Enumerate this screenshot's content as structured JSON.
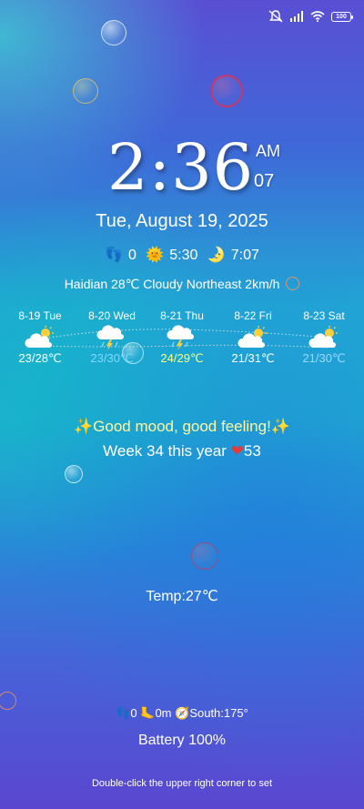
{
  "status_bar": {
    "battery": "100",
    "icons": [
      "notifications-off-icon",
      "cellular-signal-icon",
      "wifi-icon",
      "battery-icon"
    ]
  },
  "clock": {
    "time": "2:36",
    "ampm": "AM",
    "seconds": "07"
  },
  "date": "Tue, August 19, 2025",
  "stats": {
    "steps": "0",
    "sunrise": "5:30",
    "sunset": "7:07"
  },
  "location_weather": "Haidian 28℃ Cloudy Northeast 2km/h",
  "forecast": [
    {
      "label": "8-19 Tue",
      "icon": "partly-cloudy-icon",
      "temps": "23/28℃",
      "color": "#ffffff"
    },
    {
      "label": "8-20 Wed",
      "icon": "thunderstorm-icon",
      "temps": "23/30℃",
      "color": "#7fd8ff"
    },
    {
      "label": "8-21 Thu",
      "icon": "thunderstorm-icon",
      "temps": "24/29℃",
      "color": "#f4ff8a"
    },
    {
      "label": "8-22 Fri",
      "icon": "partly-cloudy-icon",
      "temps": "21/31℃",
      "color": "#ffffff"
    },
    {
      "label": "8-23 Sat",
      "icon": "partly-cloudy-icon",
      "temps": "21/30℃",
      "color": "#9fd8ff"
    }
  ],
  "mood": "✨Good mood, good feeling!✨",
  "week": {
    "text": "Week 34 this year",
    "days": "53"
  },
  "temperature": "Temp:27℃",
  "sensors": {
    "steps": "0",
    "altitude": "0m",
    "compass": "South:175°"
  },
  "battery_text": "Battery 100%",
  "hint": "Double-click the upper right corner to set",
  "colors": {
    "mood_text": "#fff6a0",
    "heart": "#e23b3b"
  }
}
